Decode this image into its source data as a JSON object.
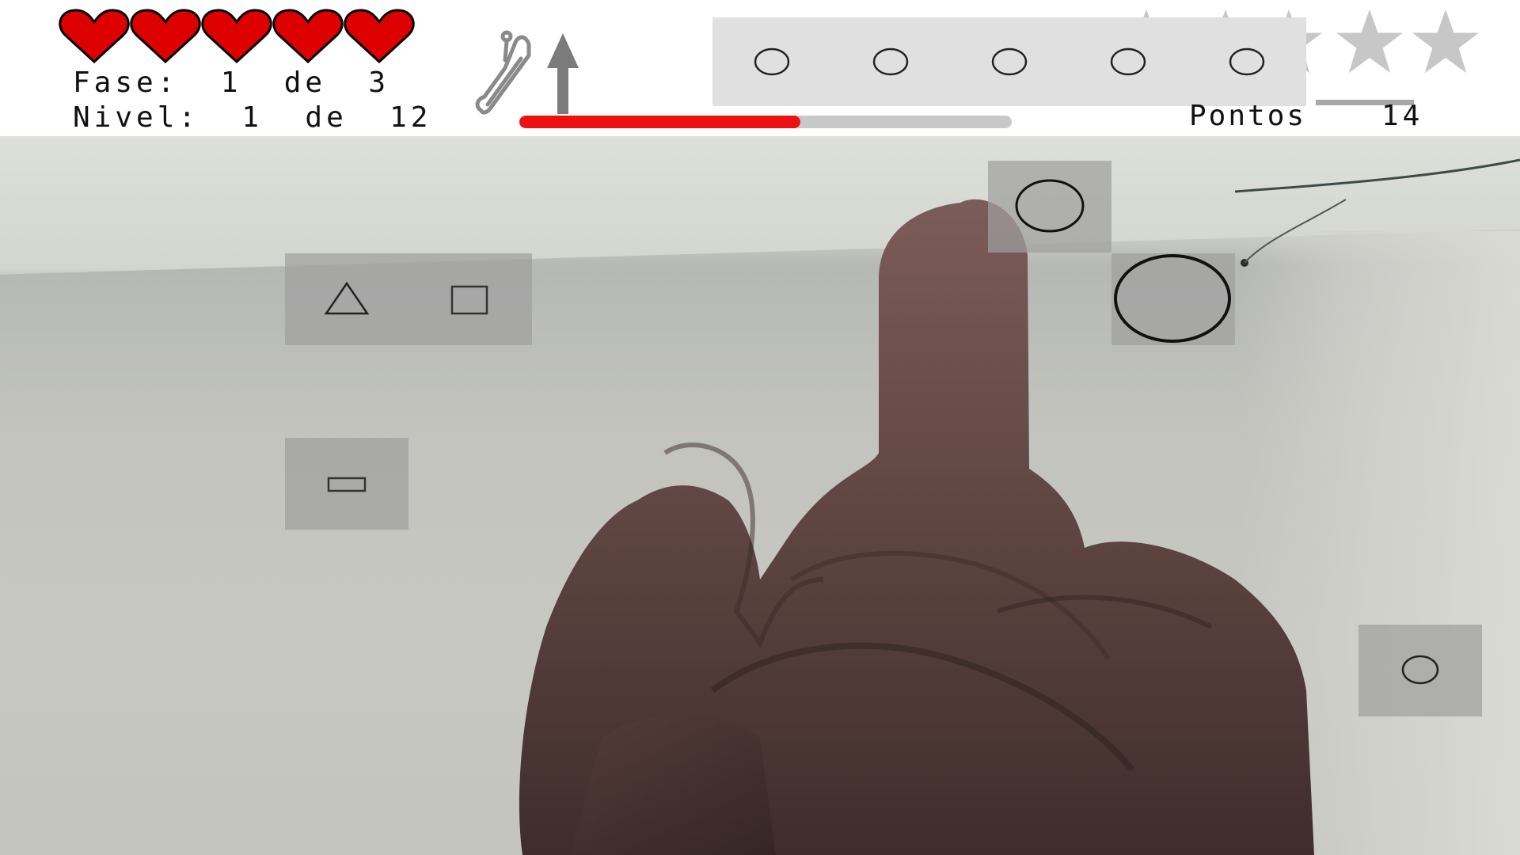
{
  "hud": {
    "lives": 5,
    "phase_text": "Fase:  1  de  3",
    "level_text": "Nivel:  1  de  12",
    "score_label": "Pontos",
    "score_value": "14",
    "progress_fraction": 0.57,
    "sequence_shapes": [
      "circle",
      "circle",
      "circle",
      "circle",
      "circle"
    ],
    "stars_earned": 0,
    "stars_total": 5,
    "colors": {
      "heart": "#dd0000",
      "progress": "#ee1111",
      "star_inactive": "#bdbdbd"
    }
  },
  "icons": {
    "lives": "heart-icon",
    "level_mode": "escalator-up-icon",
    "rating": "star-icon"
  },
  "targets": [
    {
      "shape": "triangle-square-pair"
    },
    {
      "shape": "rectangle"
    },
    {
      "shape": "circle-small"
    },
    {
      "shape": "circle-large"
    },
    {
      "shape": "circle-small"
    }
  ]
}
